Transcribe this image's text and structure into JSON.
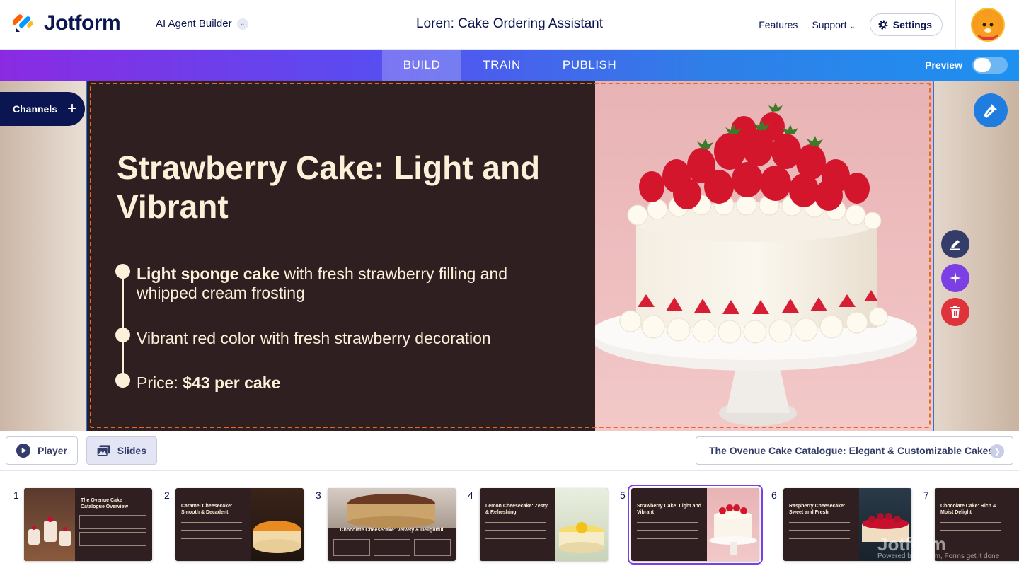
{
  "header": {
    "logo_text": "Jotform",
    "builder_label": "AI Agent Builder",
    "agent_title": "Loren: Cake Ordering Assistant",
    "features_label": "Features",
    "support_label": "Support",
    "settings_label": "Settings"
  },
  "modebar": {
    "tabs": [
      {
        "label": "BUILD",
        "active": true
      },
      {
        "label": "TRAIN",
        "active": false
      },
      {
        "label": "PUBLISH",
        "active": false
      }
    ],
    "preview_label": "Preview",
    "preview_on": false
  },
  "stage": {
    "channels_label": "Channels",
    "slide": {
      "title": "Strawberry Cake: Light and Vibrant",
      "bullets": [
        {
          "bold": "Light sponge cake",
          "rest": " with fresh strawberry filling and whipped cream frosting"
        },
        {
          "bold": "",
          "rest": "Vibrant red color with fresh strawberry decoration"
        },
        {
          "prefix": "Price: ",
          "bold": "$43 per cake",
          "rest": ""
        }
      ],
      "image_icon": "strawberry-cake-image"
    }
  },
  "controls": {
    "player_label": "Player",
    "slides_label": "Slides",
    "catalogue_label": "The Ovenue Cake Catalogue: Elegant & Customizable Cakes"
  },
  "thumbnails": [
    {
      "num": "1",
      "title": "The Ovenue Cake Catalogue Overview"
    },
    {
      "num": "2",
      "title": "Caramel Cheesecake: Smooth & Decadent"
    },
    {
      "num": "3",
      "title": "Chocolate Cheesecake: Velvety & Delightful"
    },
    {
      "num": "4",
      "title": "Lemon Cheesecake: Zesty & Refreshing"
    },
    {
      "num": "5",
      "title": "Strawberry Cake: Light and Vibrant"
    },
    {
      "num": "6",
      "title": "Raspberry Cheesecake: Sweet and Fresh"
    },
    {
      "num": "7",
      "title": "Chocolate Cake: Rich & Moist Delight"
    }
  ],
  "watermark": {
    "text": "Jotform",
    "sub": "Powered by Jotform, Forms get it done"
  },
  "colors": {
    "brand_navy": "#0a1551",
    "slide_bg": "#2f1f21",
    "slide_text": "#fbf0d8",
    "dashed_outline": "#e86a1c",
    "fab_blue": "#1f7de0",
    "magic_purple": "#7b3fe4",
    "delete_red": "#e0323a"
  }
}
